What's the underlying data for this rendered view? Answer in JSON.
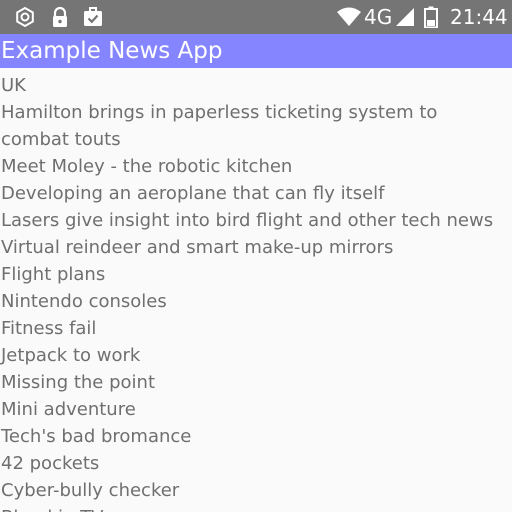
{
  "status_bar": {
    "icons": [
      "camera-icon",
      "lock-icon",
      "briefcase-icon",
      "wifi-icon",
      "signal-icon",
      "battery-icon"
    ],
    "network": "4G",
    "time": "21:44",
    "colors": {
      "background": "#757575",
      "foreground": "#ffffff"
    }
  },
  "app_bar": {
    "title": "Example News App",
    "color": "#8585ff"
  },
  "articles": [
    "New high-tech driverless car approved for testing in the UK",
    "Hamilton brings in paperless ticketing system to combat touts",
    "Meet Moley - the robotic kitchen",
    "Developing an aeroplane that can fly itself",
    "Lasers give insight into bird flight and other tech news",
    "Virtual reindeer and smart make-up mirrors",
    "Flight plans",
    "Nintendo consoles",
    "Fitness fail",
    "Jetpack to work",
    "Missing the point",
    "Mini adventure",
    "Tech's bad bromance",
    "42 pockets",
    "Cyber-bully checker",
    "Blend in TVs"
  ],
  "colors": {
    "list_text": "#6f6f6f",
    "background": "#fafafa"
  }
}
